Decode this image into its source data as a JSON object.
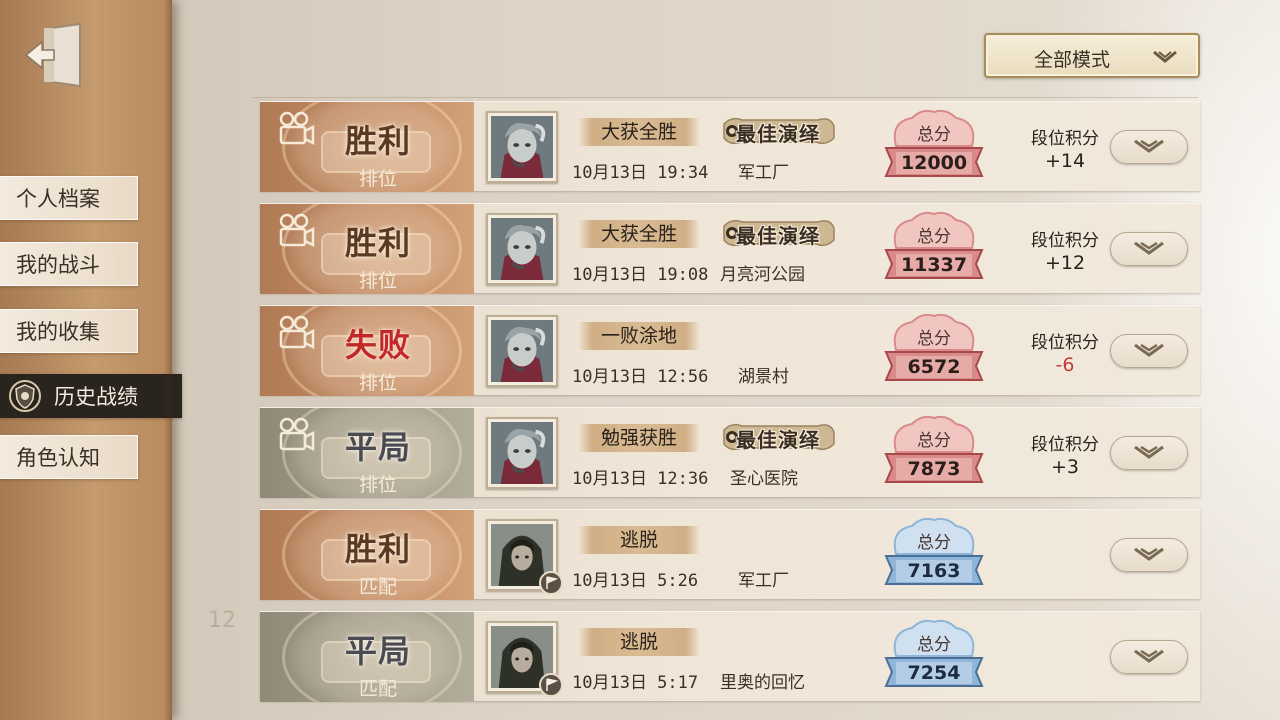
{
  "sidebar": {
    "back_icon": "exit-door-icon",
    "items": [
      {
        "label": "个人档案",
        "active": false
      },
      {
        "label": "我的战斗",
        "active": false
      },
      {
        "label": "我的收集",
        "active": false
      },
      {
        "label": "历史战绩",
        "active": true,
        "icon": "shield-badge-icon"
      },
      {
        "label": "角色认知",
        "active": false
      }
    ]
  },
  "filter": {
    "mode_label": "全部模式",
    "icon": "chevron-down-icon"
  },
  "background_number": "12",
  "colors": {
    "win_badge": "#c58e66",
    "draw_badge": "#a49f8c",
    "loss_text": "#c22828",
    "score_red": "#d98a8a",
    "score_blue": "#8fb5d8",
    "active_nav": "#2a241e"
  },
  "matches": [
    {
      "result": "胜利",
      "result_type": "win",
      "match_type": "排位",
      "outcome": "大获全胜",
      "mvp": "最佳演绎",
      "date": "10月13日 19:34",
      "map": "军工厂",
      "score_label": "总分",
      "score": "12000",
      "score_color": "red",
      "rank_label": "段位积分",
      "rank_points": "+14"
    },
    {
      "result": "胜利",
      "result_type": "win",
      "match_type": "排位",
      "outcome": "大获全胜",
      "mvp": "最佳演绎",
      "date": "10月13日 19:08",
      "map": "月亮河公园",
      "score_label": "总分",
      "score": "11337",
      "score_color": "red",
      "rank_label": "段位积分",
      "rank_points": "+12"
    },
    {
      "result": "失败",
      "result_type": "lose",
      "match_type": "排位",
      "outcome": "一败涂地",
      "mvp": "",
      "date": "10月13日 12:56",
      "map": "湖景村",
      "score_label": "总分",
      "score": "6572",
      "score_color": "red",
      "rank_label": "段位积分",
      "rank_points": "-6"
    },
    {
      "result": "平局",
      "result_type": "draw",
      "match_type": "排位",
      "outcome": "勉强获胜",
      "mvp": "最佳演绎",
      "date": "10月13日 12:36",
      "map": "圣心医院",
      "score_label": "总分",
      "score": "7873",
      "score_color": "red",
      "rank_label": "段位积分",
      "rank_points": "+3"
    },
    {
      "result": "胜利",
      "result_type": "win",
      "match_type": "匹配",
      "outcome": "逃脱",
      "mvp": "",
      "date": "10月13日 5:26",
      "map": "军工厂",
      "score_label": "总分",
      "score": "7163",
      "score_color": "blue",
      "rank_label": "",
      "rank_points": ""
    },
    {
      "result": "平局",
      "result_type": "draw",
      "match_type": "匹配",
      "outcome": "逃脱",
      "mvp": "",
      "date": "10月13日 5:17",
      "map": "里奥的回忆",
      "score_label": "总分",
      "score": "7254",
      "score_color": "blue",
      "rank_label": "",
      "rank_points": ""
    }
  ]
}
